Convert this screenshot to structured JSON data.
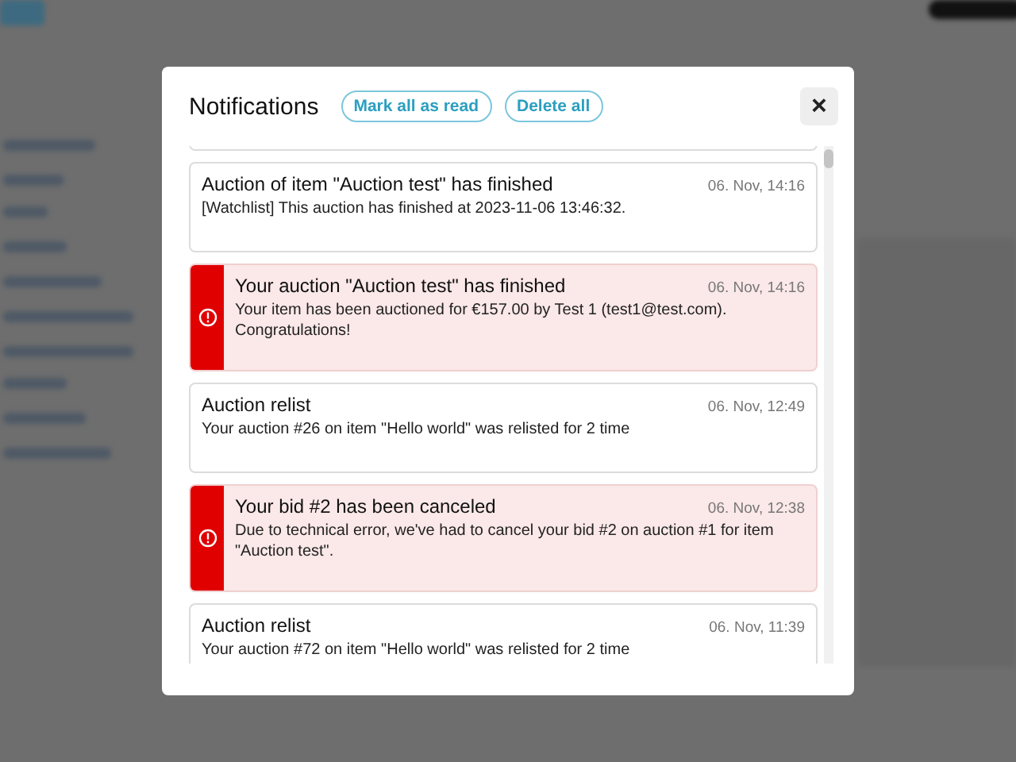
{
  "dialog": {
    "title": "Notifications",
    "actions": [
      {
        "label": "Mark all as read"
      },
      {
        "label": "Delete all"
      }
    ],
    "close": "×"
  },
  "notifications": [
    {
      "kind": "info",
      "title": "Auction of item \"Auction test\" has finished",
      "time": "06. Nov, 14:16",
      "body": "[Watchlist] This auction has finished at 2023-11-06 13:46:32."
    },
    {
      "kind": "alert",
      "title": "Your auction \"Auction test\" has finished",
      "time": "06. Nov, 14:16",
      "body": "Your item has been auctioned for €157.00 by Test 1 (test1@test.com). Congratulations!"
    },
    {
      "kind": "info",
      "title": "Auction relist",
      "time": "06. Nov, 12:49",
      "body": "Your auction #26 on item \"Hello world\" was relisted for 2 time"
    },
    {
      "kind": "alert",
      "title": "Your bid #2 has been canceled",
      "time": "06. Nov, 12:38",
      "body": "Due to technical error, we've had to cancel your bid #2 on auction #1 for item \"Auction test\"."
    },
    {
      "kind": "info",
      "title": "Auction relist",
      "time": "06. Nov, 11:39",
      "body": "Your auction #72 on item \"Hello world\" was relisted for 2 time"
    }
  ]
}
